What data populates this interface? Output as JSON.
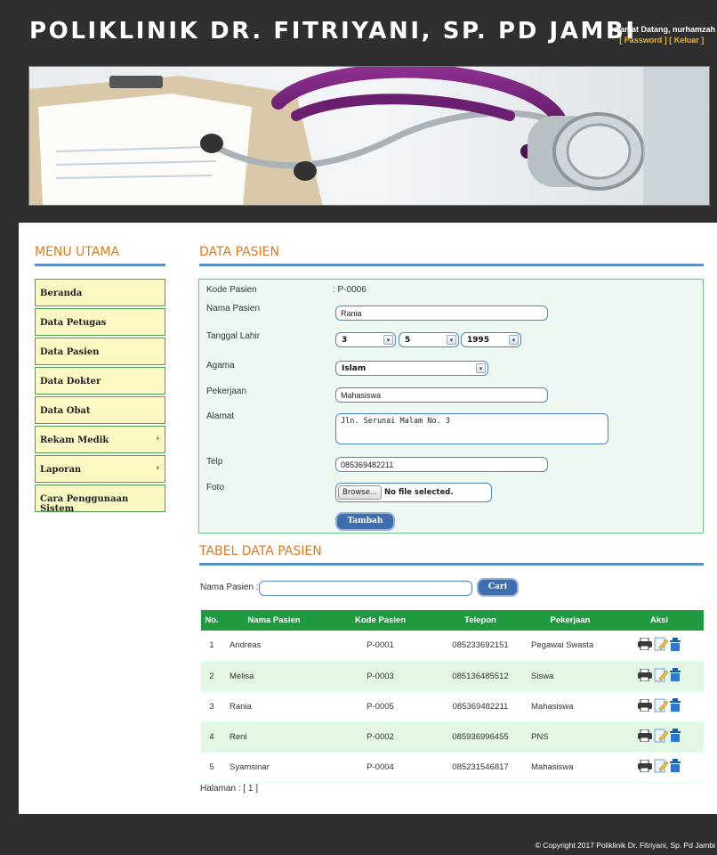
{
  "header": {
    "title": "POLIKLINIK DR. FITRIYANI, SP. PD JAMBI",
    "welcome": "Selamat Datang, nurhamzah",
    "password_link": "[ Password ]",
    "logout_link": "[ Keluar ]"
  },
  "menu": {
    "title": "MENU UTAMA",
    "items": [
      {
        "label": "Beranda",
        "arrow": ""
      },
      {
        "label": "Data Petugas",
        "arrow": ""
      },
      {
        "label": "Data Pasien",
        "arrow": ""
      },
      {
        "label": "Data Dokter",
        "arrow": ""
      },
      {
        "label": "Data Obat",
        "arrow": ""
      },
      {
        "label": "Rekam Medik",
        "arrow": "›"
      },
      {
        "label": "Laporan",
        "arrow": "›"
      },
      {
        "label": "Cara Penggunaan Sistem",
        "arrow": ""
      }
    ]
  },
  "form": {
    "title": "DATA PASIEN",
    "labels": {
      "kode": "Kode Pasien",
      "nama": "Nama Pasien",
      "tgl": "Tanggal Lahir",
      "agama": "Agama",
      "pekerjaan": "Pekerjaan",
      "alamat": "Alamat",
      "telp": "Telp",
      "foto": "Foto"
    },
    "kode_value": ": P-0006",
    "nama_value": "Rania",
    "tgl_day": "3",
    "tgl_month": "5",
    "tgl_year": "1995",
    "agama_value": "Islam",
    "pekerjaan_value": "Mahasiswa",
    "alamat_value": "Jln. Serunai Malam No. 3",
    "telp_value": "085369482211",
    "browse_label": "Browse...",
    "file_status": "No file selected.",
    "submit_label": "Tambah"
  },
  "table_section": {
    "title": "TABEL DATA PASIEN",
    "search_label": "Nama Pasien :",
    "search_value": "",
    "search_button": "Cari",
    "headers": [
      "No.",
      "Nama Pasien",
      "Kode Pasien",
      "Telepon",
      "Pekerjaan",
      "Aksi"
    ],
    "rows": [
      {
        "no": "1",
        "nama": "Andreas",
        "kode": "P-0001",
        "telepon": "085233692151",
        "pekerjaan": "Pegawai Swasta"
      },
      {
        "no": "2",
        "nama": "Melisa",
        "kode": "P-0003",
        "telepon": "085136485512",
        "pekerjaan": "Siswa"
      },
      {
        "no": "3",
        "nama": "Rania",
        "kode": "P-0005",
        "telepon": "085369482211",
        "pekerjaan": "Mahasiswa"
      },
      {
        "no": "4",
        "nama": "Reni",
        "kode": "P-0002",
        "telepon": "085936996455",
        "pekerjaan": "PNS"
      },
      {
        "no": "5",
        "nama": "Syamsinar",
        "kode": "P-0004",
        "telepon": "085231546817",
        "pekerjaan": "Mahasiswa"
      }
    ],
    "pagination": "Halaman : [ 1 ]"
  },
  "footer": {
    "copyright": "© Copyright 2017 Poliklinik Dr. Fitriyani, Sp. Pd Jambi"
  },
  "icons": {
    "print": "print-icon",
    "edit": "edit-icon",
    "delete": "delete-icon"
  },
  "colors": {
    "accent": "#e07a1a",
    "menu_bg": "#fcf8c4",
    "table_header": "#1f9a3e",
    "button": "#3f6eb0"
  }
}
